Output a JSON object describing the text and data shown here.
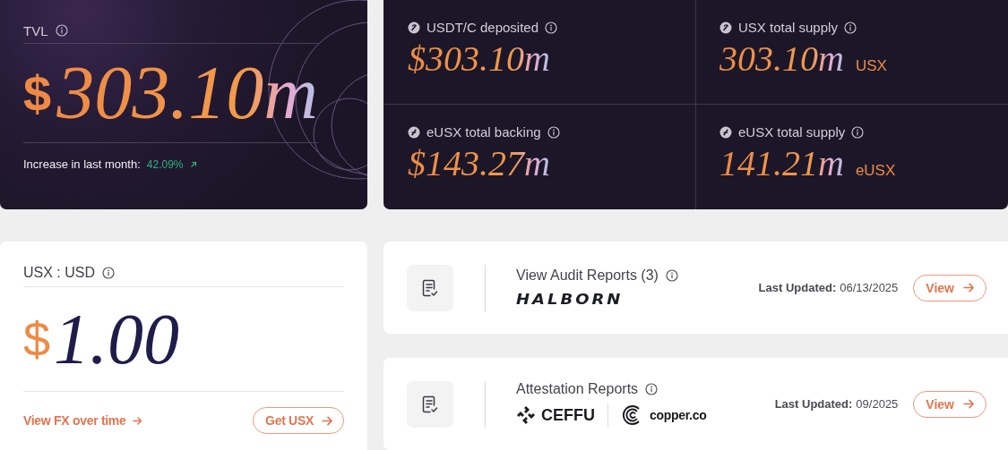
{
  "tvl": {
    "label": "TVL",
    "currency": "$",
    "value": "303.10m",
    "change_label": "Increase in last month:",
    "change": "42.09%"
  },
  "stats": [
    {
      "kind": "usx",
      "label": "USDT/C deposited",
      "value": "$303.10m"
    },
    {
      "kind": "usx",
      "label": "USX total supply",
      "value": "303.10m",
      "unit": "USX"
    },
    {
      "kind": "eusx",
      "label": "eUSX total backing",
      "value": "$143.27m"
    },
    {
      "kind": "eusx",
      "label": "eUSX total supply",
      "value": "141.21m",
      "unit": "eUSX"
    }
  ],
  "fx": {
    "label": "USX : USD",
    "currency": "$",
    "value": "1.00",
    "link": "View FX over time",
    "button": "Get USX"
  },
  "reports": [
    {
      "title": "View Audit Reports (3)",
      "logos": [
        {
          "kind": "halborn",
          "text": "HALBORN"
        }
      ],
      "updated_label": "Last Updated:",
      "updated": "06/13/2025",
      "button": "View"
    },
    {
      "title": "Attestation Reports",
      "logos": [
        {
          "kind": "ceffu",
          "text": "CEFFU"
        },
        {
          "kind": "copper",
          "text": "copper.co"
        }
      ],
      "updated_label": "Last Updated:",
      "updated": "09/2025",
      "button": "View"
    }
  ]
}
